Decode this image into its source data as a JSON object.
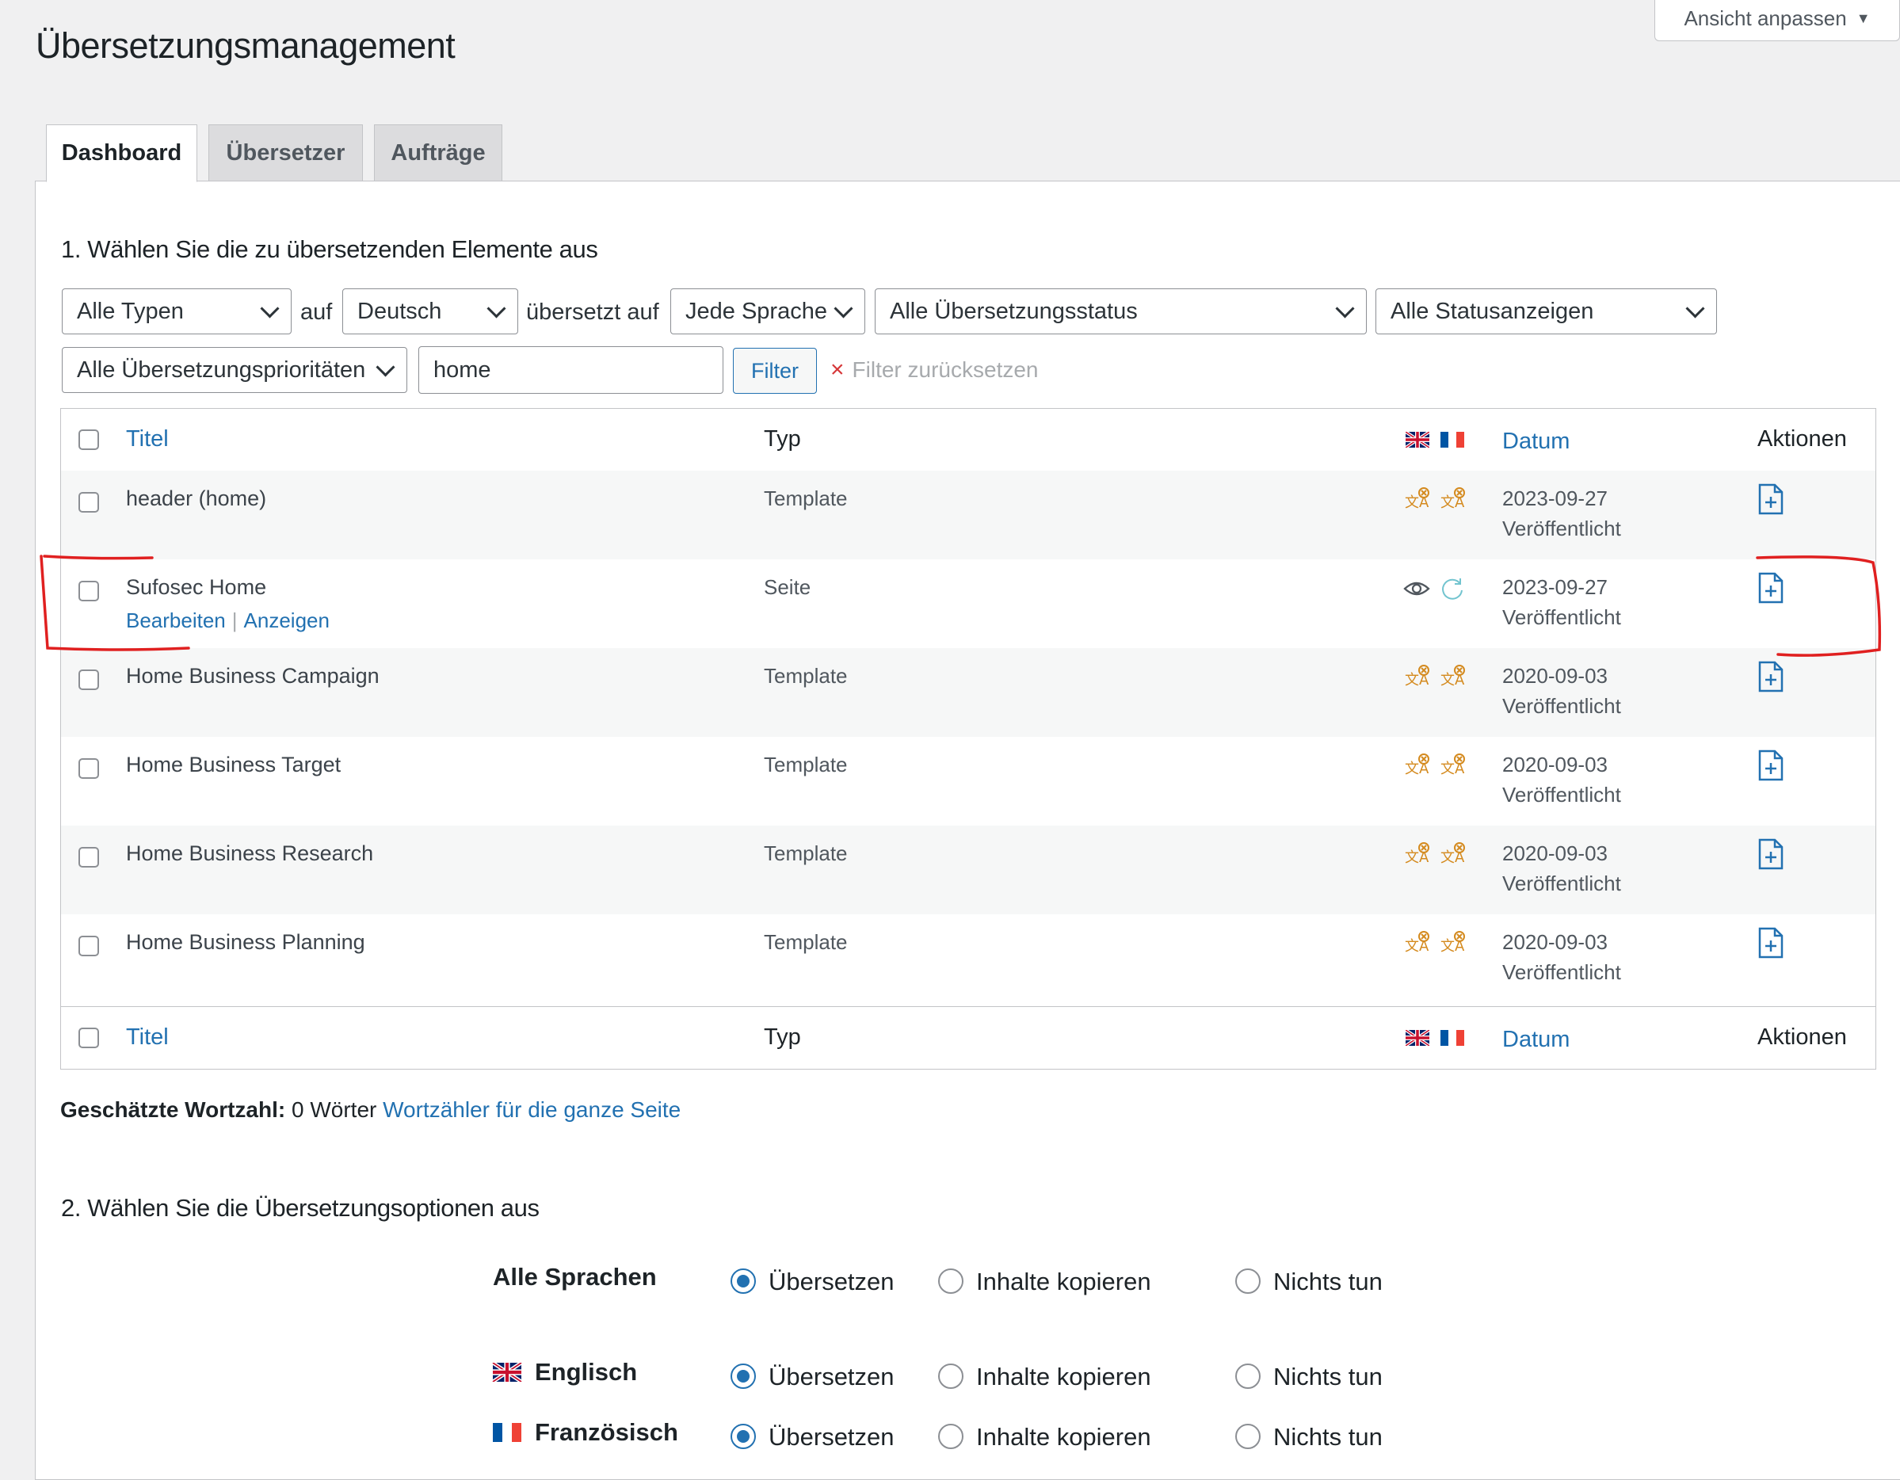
{
  "page": {
    "title": "Übersetzungsmanagement",
    "screen_options": "Ansicht anpassen"
  },
  "tabs": [
    {
      "label": "Dashboard",
      "active": true
    },
    {
      "label": "Übersetzer",
      "active": false
    },
    {
      "label": "Aufträge",
      "active": false
    }
  ],
  "section1": {
    "heading": "1. Wählen Sie die zu übersetzenden Elemente aus",
    "filters": {
      "type": "Alle Typen",
      "auf": "auf",
      "source_lang": "Deutsch",
      "translated_to": "übersetzt auf",
      "target_lang": "Jede Sprache",
      "translation_status": "Alle Übersetzungsstatus",
      "status_display": "Alle Statusanzeigen",
      "priority": "Alle Übersetzungsprioritäten",
      "search_value": "home",
      "filter_button": "Filter",
      "reset": "Filter zurücksetzen"
    }
  },
  "table": {
    "headers": {
      "title": "Titel",
      "type": "Typ",
      "date": "Datum",
      "actions": "Aktionen"
    },
    "language_flags": [
      "uk-flag-icon",
      "france-flag-icon"
    ],
    "rows": [
      {
        "title": "header (home)",
        "type": "Template",
        "date": "2023-09-27",
        "status": "Veröffentlicht",
        "en_status": "needs-translation",
        "fr_status": "needs-translation"
      },
      {
        "title": "Sufosec Home",
        "type": "Seite",
        "date": "2023-09-27",
        "status": "Veröffentlicht",
        "en_status": "view",
        "fr_status": "in-progress",
        "edit_link": "Bearbeiten",
        "view_link": "Anzeigen",
        "sep": "|"
      },
      {
        "title": "Home Business Campaign",
        "type": "Template",
        "date": "2020-09-03",
        "status": "Veröffentlicht",
        "en_status": "needs-translation",
        "fr_status": "needs-translation"
      },
      {
        "title": "Home Business Target",
        "type": "Template",
        "date": "2020-09-03",
        "status": "Veröffentlicht",
        "en_status": "needs-translation",
        "fr_status": "needs-translation"
      },
      {
        "title": "Home Business Research",
        "type": "Template",
        "date": "2020-09-03",
        "status": "Veröffentlicht",
        "en_status": "needs-translation",
        "fr_status": "needs-translation"
      },
      {
        "title": "Home Business Planning",
        "type": "Template",
        "date": "2020-09-03",
        "status": "Veröffentlicht",
        "en_status": "needs-translation",
        "fr_status": "needs-translation"
      }
    ]
  },
  "word_count": {
    "label": "Geschätzte Wortzahl:",
    "value": "0 Wörter",
    "link": "Wortzähler für die ganze Seite"
  },
  "section2": {
    "heading": "2. Wählen Sie die Übersetzungsoptionen aus",
    "options": {
      "translate": "Übersetzen",
      "copy": "Inhalte kopieren",
      "nothing": "Nichts tun"
    },
    "languages": [
      {
        "label": "Alle Sprachen",
        "flag": null,
        "selected": "translate"
      },
      {
        "label": "Englisch",
        "flag": "uk-flag-icon",
        "selected": "translate"
      },
      {
        "label": "Französisch",
        "flag": "france-flag-icon",
        "selected": "translate"
      }
    ]
  },
  "colors": {
    "link": "#2271b1",
    "status_orange": "#d48a1e",
    "annotation_red": "#e02020"
  }
}
